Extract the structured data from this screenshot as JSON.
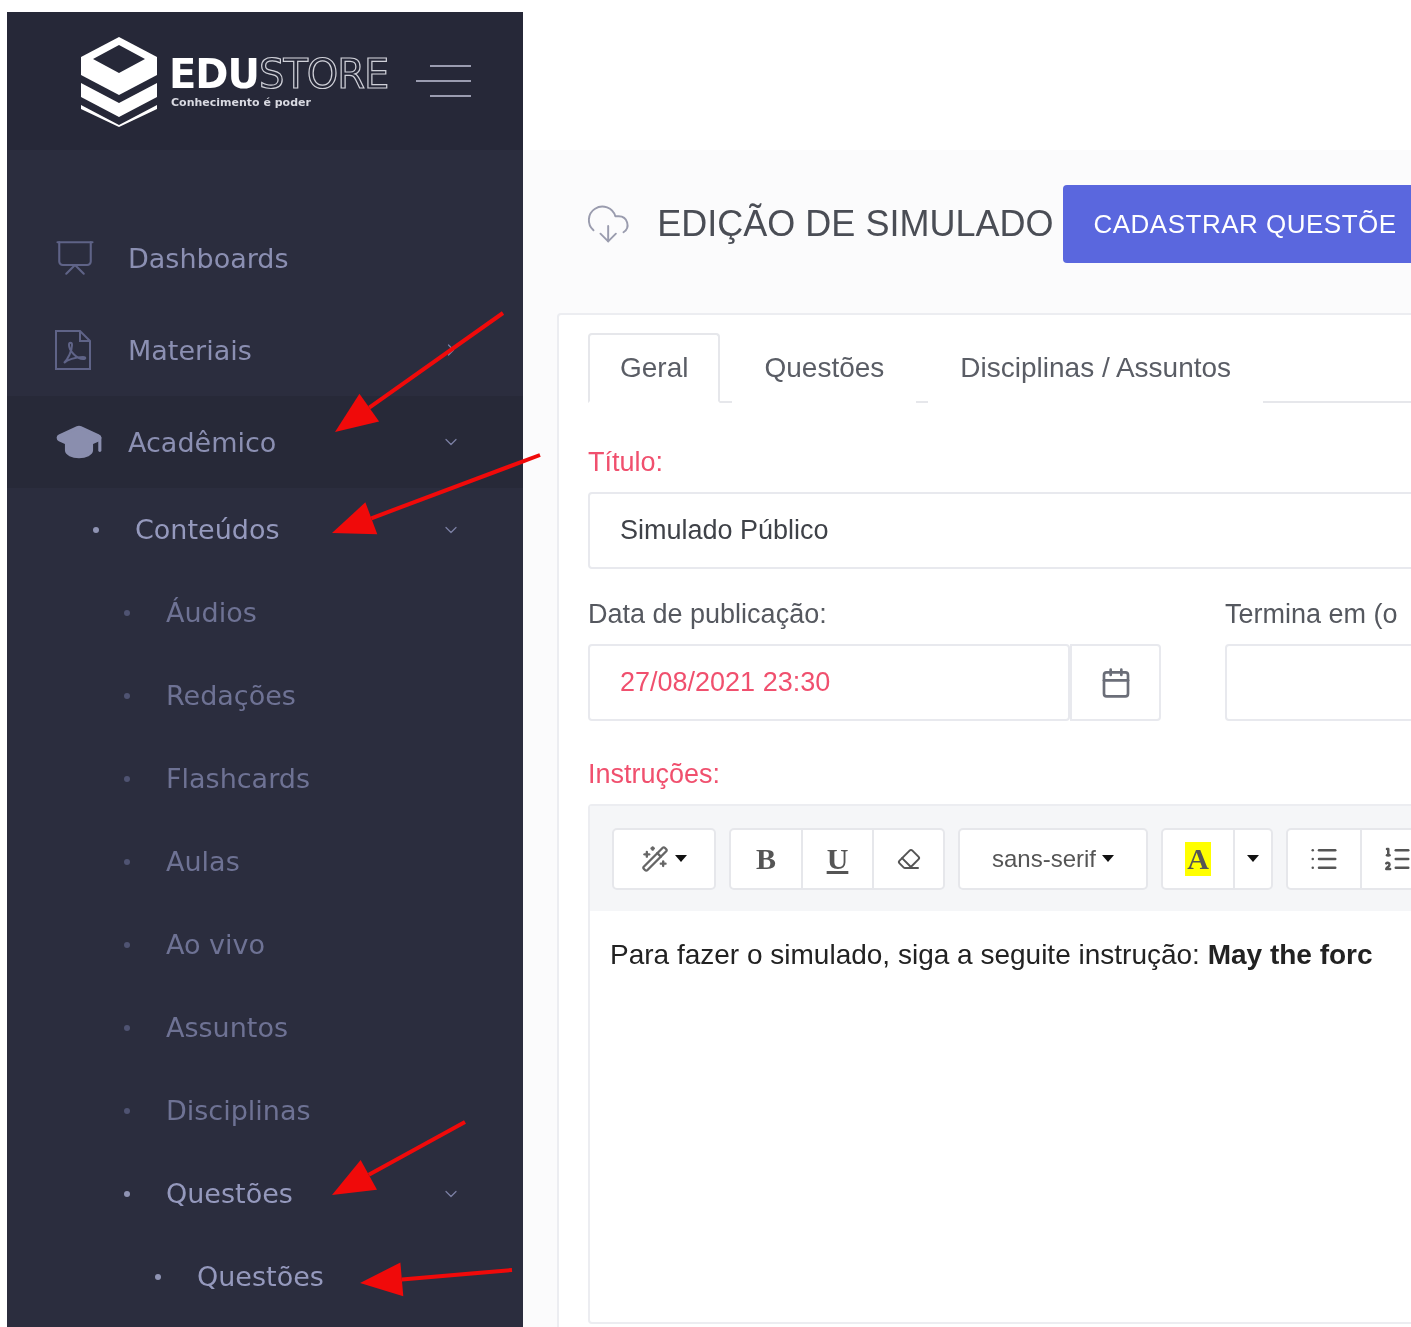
{
  "brand": {
    "name_bold": "EDU",
    "name_outline": "STORE",
    "tagline": "Conhecimento é poder"
  },
  "sidebar": {
    "items": [
      {
        "label": "Dashboards"
      },
      {
        "label": "Materiais",
        "expanded": false
      },
      {
        "label": "Acadêmico",
        "expanded": true,
        "children": [
          {
            "label": "Conteúdos",
            "active": true,
            "expanded": true,
            "children": [
              {
                "label": "Áudios",
                "active": false
              },
              {
                "label": "Redações",
                "active": false
              },
              {
                "label": "Flashcards",
                "active": false
              },
              {
                "label": "Aulas",
                "active": false
              },
              {
                "label": "Ao vivo",
                "active": false
              },
              {
                "label": "Assuntos",
                "active": false
              },
              {
                "label": "Disciplinas",
                "active": false
              },
              {
                "label": "Questões",
                "active": true,
                "expanded": true,
                "children": [
                  {
                    "label": "Questões",
                    "active": true
                  }
                ]
              }
            ]
          }
        ]
      }
    ]
  },
  "page": {
    "title": "EDIÇÃO DE SIMULADO",
    "action_button": "CADASTRAR QUESTÕE"
  },
  "tabs": [
    {
      "label": "Geral",
      "selected": true
    },
    {
      "label": "Questões",
      "selected": false
    },
    {
      "label": "Disciplinas / Assuntos",
      "selected": false
    }
  ],
  "form": {
    "title_field": {
      "label": "Título:",
      "value": "Simulado Público",
      "error": true
    },
    "date_field": {
      "label": "Data de publicação:",
      "value": "27/08/2021 23:30",
      "error": false,
      "value_error": true
    },
    "end_field": {
      "label": "Termina em (o",
      "error": false
    },
    "instructions": {
      "label": "Instruções:",
      "error": true,
      "font": "sans-serif",
      "bold_key": "B",
      "underline_key": "U",
      "color_key": "A",
      "content": "Para fazer o simulado, siga a seguite instrução: **May the forc**"
    }
  }
}
